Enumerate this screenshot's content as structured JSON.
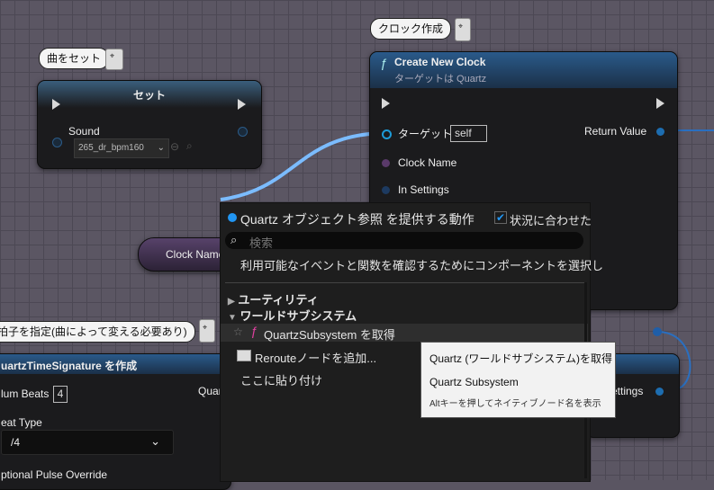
{
  "comments": {
    "set_song": "曲をセット",
    "create_clock": "クロック作成",
    "time_sig": "拍子を指定(曲によって変える必要あり)"
  },
  "set_node": {
    "title": "セット",
    "sound_label": "Sound",
    "sound_value": "265_dr_bpm160"
  },
  "clock_node": {
    "title": "Create New Clock",
    "subtitle": "ターゲットは Quartz",
    "target_label": "ターゲット",
    "target_value": "self",
    "clock_name_label": "Clock Name",
    "in_settings_label": "In Settings",
    "return_label": "Return Value"
  },
  "clock_name_node": {
    "label": "Clock Name"
  },
  "time_sig_node": {
    "title": "uartzTimeSignature を作成",
    "num_beats_label": "lum Beats",
    "num_beats_value": "4",
    "quar_label": "Quar",
    "beat_type_label": "eat Type",
    "beat_type_value": "/4",
    "pulse_label": "ptional Pulse Override"
  },
  "settings_node": {
    "label": "ettings"
  },
  "menu": {
    "title": "Quartz オブジェクト参照 を提供する動作",
    "context_label": "状況に合わせた",
    "context_checked": true,
    "search_placeholder": "検索",
    "info": "利用可能なイベントと関数を確認するためにコンポーネントを選択し",
    "cat_utility": "ユーティリティ",
    "cat_world": "ワールドサブシステム",
    "item_get": "QuartzSubsystem を取得",
    "item_reroute": "Rerouteノードを追加...",
    "item_paste": "ここに貼り付け"
  },
  "tooltip": {
    "line1": "Quartz (ワールドサブシステム)を取得",
    "line2": "Quartz Subsystem",
    "line3": "Altキーを押してネイティブノード名を表示"
  },
  "colors": {
    "object_pin": "#1d9bd8",
    "name_pin": "#9c5fb2",
    "struct_pin": "#2070c0",
    "wire": "#7bbcff",
    "menu_header_accent": "#2196f3"
  }
}
